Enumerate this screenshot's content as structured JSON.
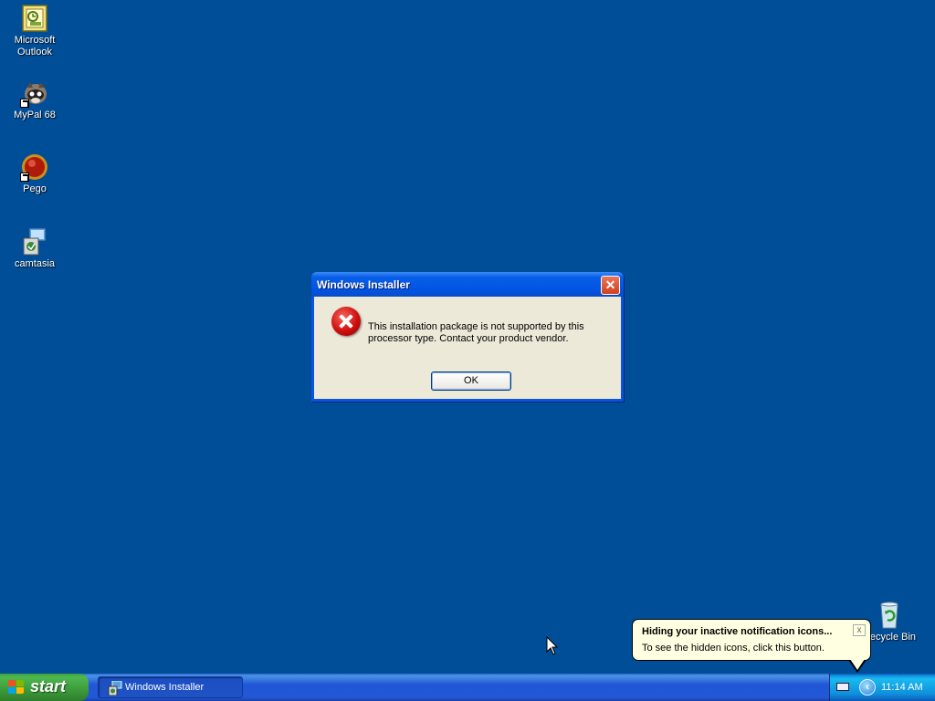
{
  "desktop": {
    "background_color": "#004e98",
    "icons": [
      {
        "label_line1": "Microsoft",
        "label_line2": "Outlook",
        "icon": "outlook-icon"
      },
      {
        "label_line1": "MyPal 68",
        "icon": "mypal-icon"
      },
      {
        "label_line1": "Pego",
        "icon": "pego-icon"
      },
      {
        "label_line1": "camtasia",
        "icon": "camtasia-icon"
      },
      {
        "label_line1": "Recycle Bin",
        "icon": "recycle-bin-icon"
      }
    ]
  },
  "dialog": {
    "title": "Windows Installer",
    "close_label": "✕",
    "message_line1": "This installation package is not supported by this",
    "message_line2": "processor type. Contact your product vendor.",
    "ok_label": "OK",
    "icon": "error-icon"
  },
  "taskbar": {
    "start_label": "start",
    "tasks": [
      {
        "label": "Windows Installer",
        "icon": "installer-icon"
      }
    ],
    "clock": "11:14 AM",
    "chevron_label": "‹"
  },
  "balloon": {
    "title": "Hiding your inactive notification icons...",
    "text": "To see the hidden icons, click this button.",
    "close_label": "x"
  }
}
